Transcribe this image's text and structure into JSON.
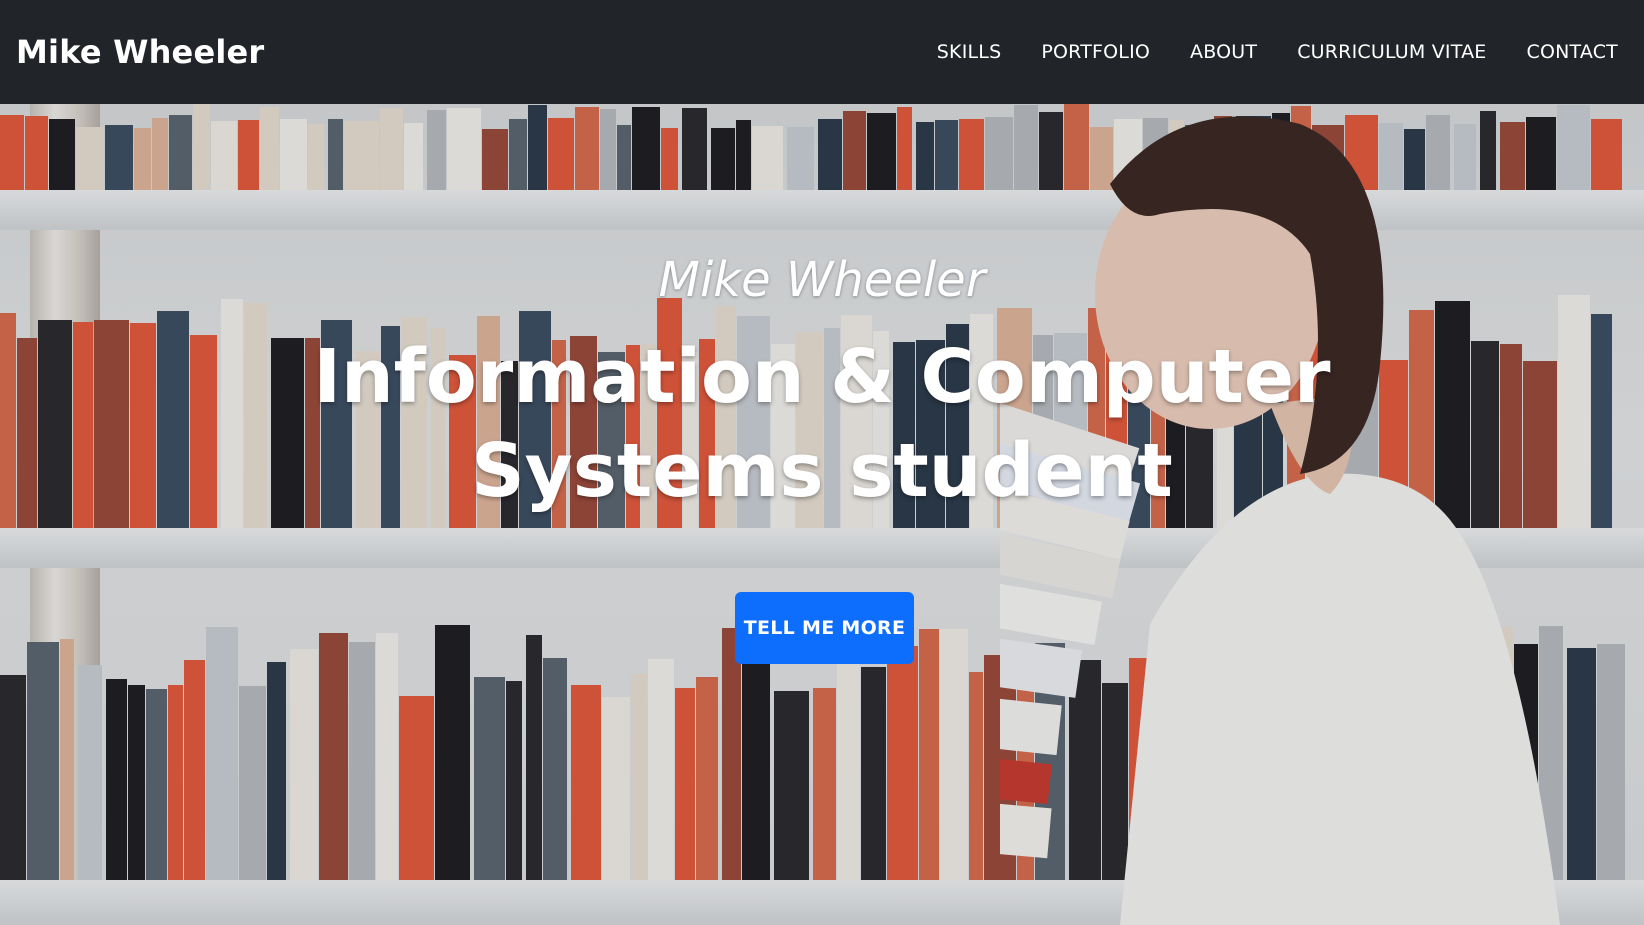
{
  "navbar": {
    "brand": "Mike Wheeler",
    "links": [
      {
        "label": "SKILLS"
      },
      {
        "label": "PORTFOLIO"
      },
      {
        "label": "ABOUT"
      },
      {
        "label": "CURRICULUM VITAE"
      },
      {
        "label": "CONTACT"
      }
    ]
  },
  "hero": {
    "subtitle": "Mike Wheeler",
    "title": "Information & Computer Systems student",
    "button_label": "TELL ME MORE"
  },
  "colors": {
    "navbar_bg": "#212529",
    "button_bg": "#0d6efd",
    "text": "#ffffff"
  }
}
